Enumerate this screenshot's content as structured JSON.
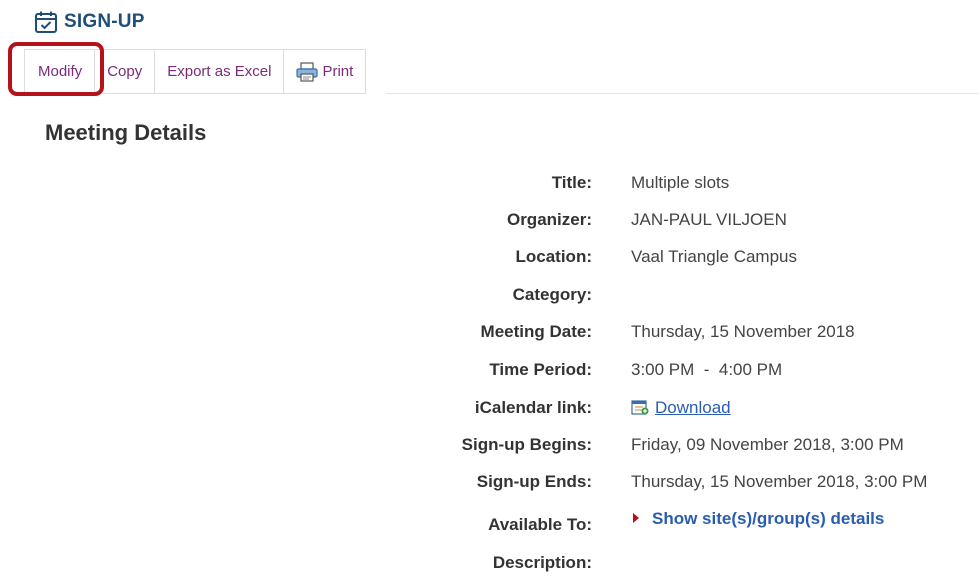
{
  "tool": {
    "title": "SIGN-UP",
    "icon": "calendar-check-icon"
  },
  "toolbar": {
    "modify_label": "Modify",
    "copy_label": "Copy",
    "export_label": "Export as Excel",
    "print_label": "Print"
  },
  "section": {
    "title": "Meeting Details"
  },
  "details": {
    "title_label": "Title:",
    "title_value": "Multiple slots",
    "organizer_label": "Organizer:",
    "organizer_value": "JAN-PAUL VILJOEN",
    "location_label": "Location:",
    "location_value": "Vaal Triangle Campus",
    "category_label": "Category:",
    "category_value": "",
    "meeting_date_label": "Meeting Date:",
    "meeting_date_value": "Thursday, 15 November 2018",
    "time_period_label": "Time Period:",
    "time_period_value": "3:00 PM  -  4:00 PM",
    "icalendar_label": "iCalendar link:",
    "icalendar_link": "Download",
    "signup_begins_label": "Sign-up Begins:",
    "signup_begins_value": "Friday, 09 November 2018, 3:00 PM",
    "signup_ends_label": "Sign-up Ends:",
    "signup_ends_value": "Thursday, 15 November 2018, 3:00 PM",
    "available_to_label": "Available To:",
    "available_to_toggle": "Show site(s)/group(s) details",
    "description_label": "Description:"
  },
  "colors": {
    "accent": "#1f4e79",
    "toolbar_text": "#7a2c78",
    "highlight": "#b5131b",
    "link": "#2a5db0"
  }
}
